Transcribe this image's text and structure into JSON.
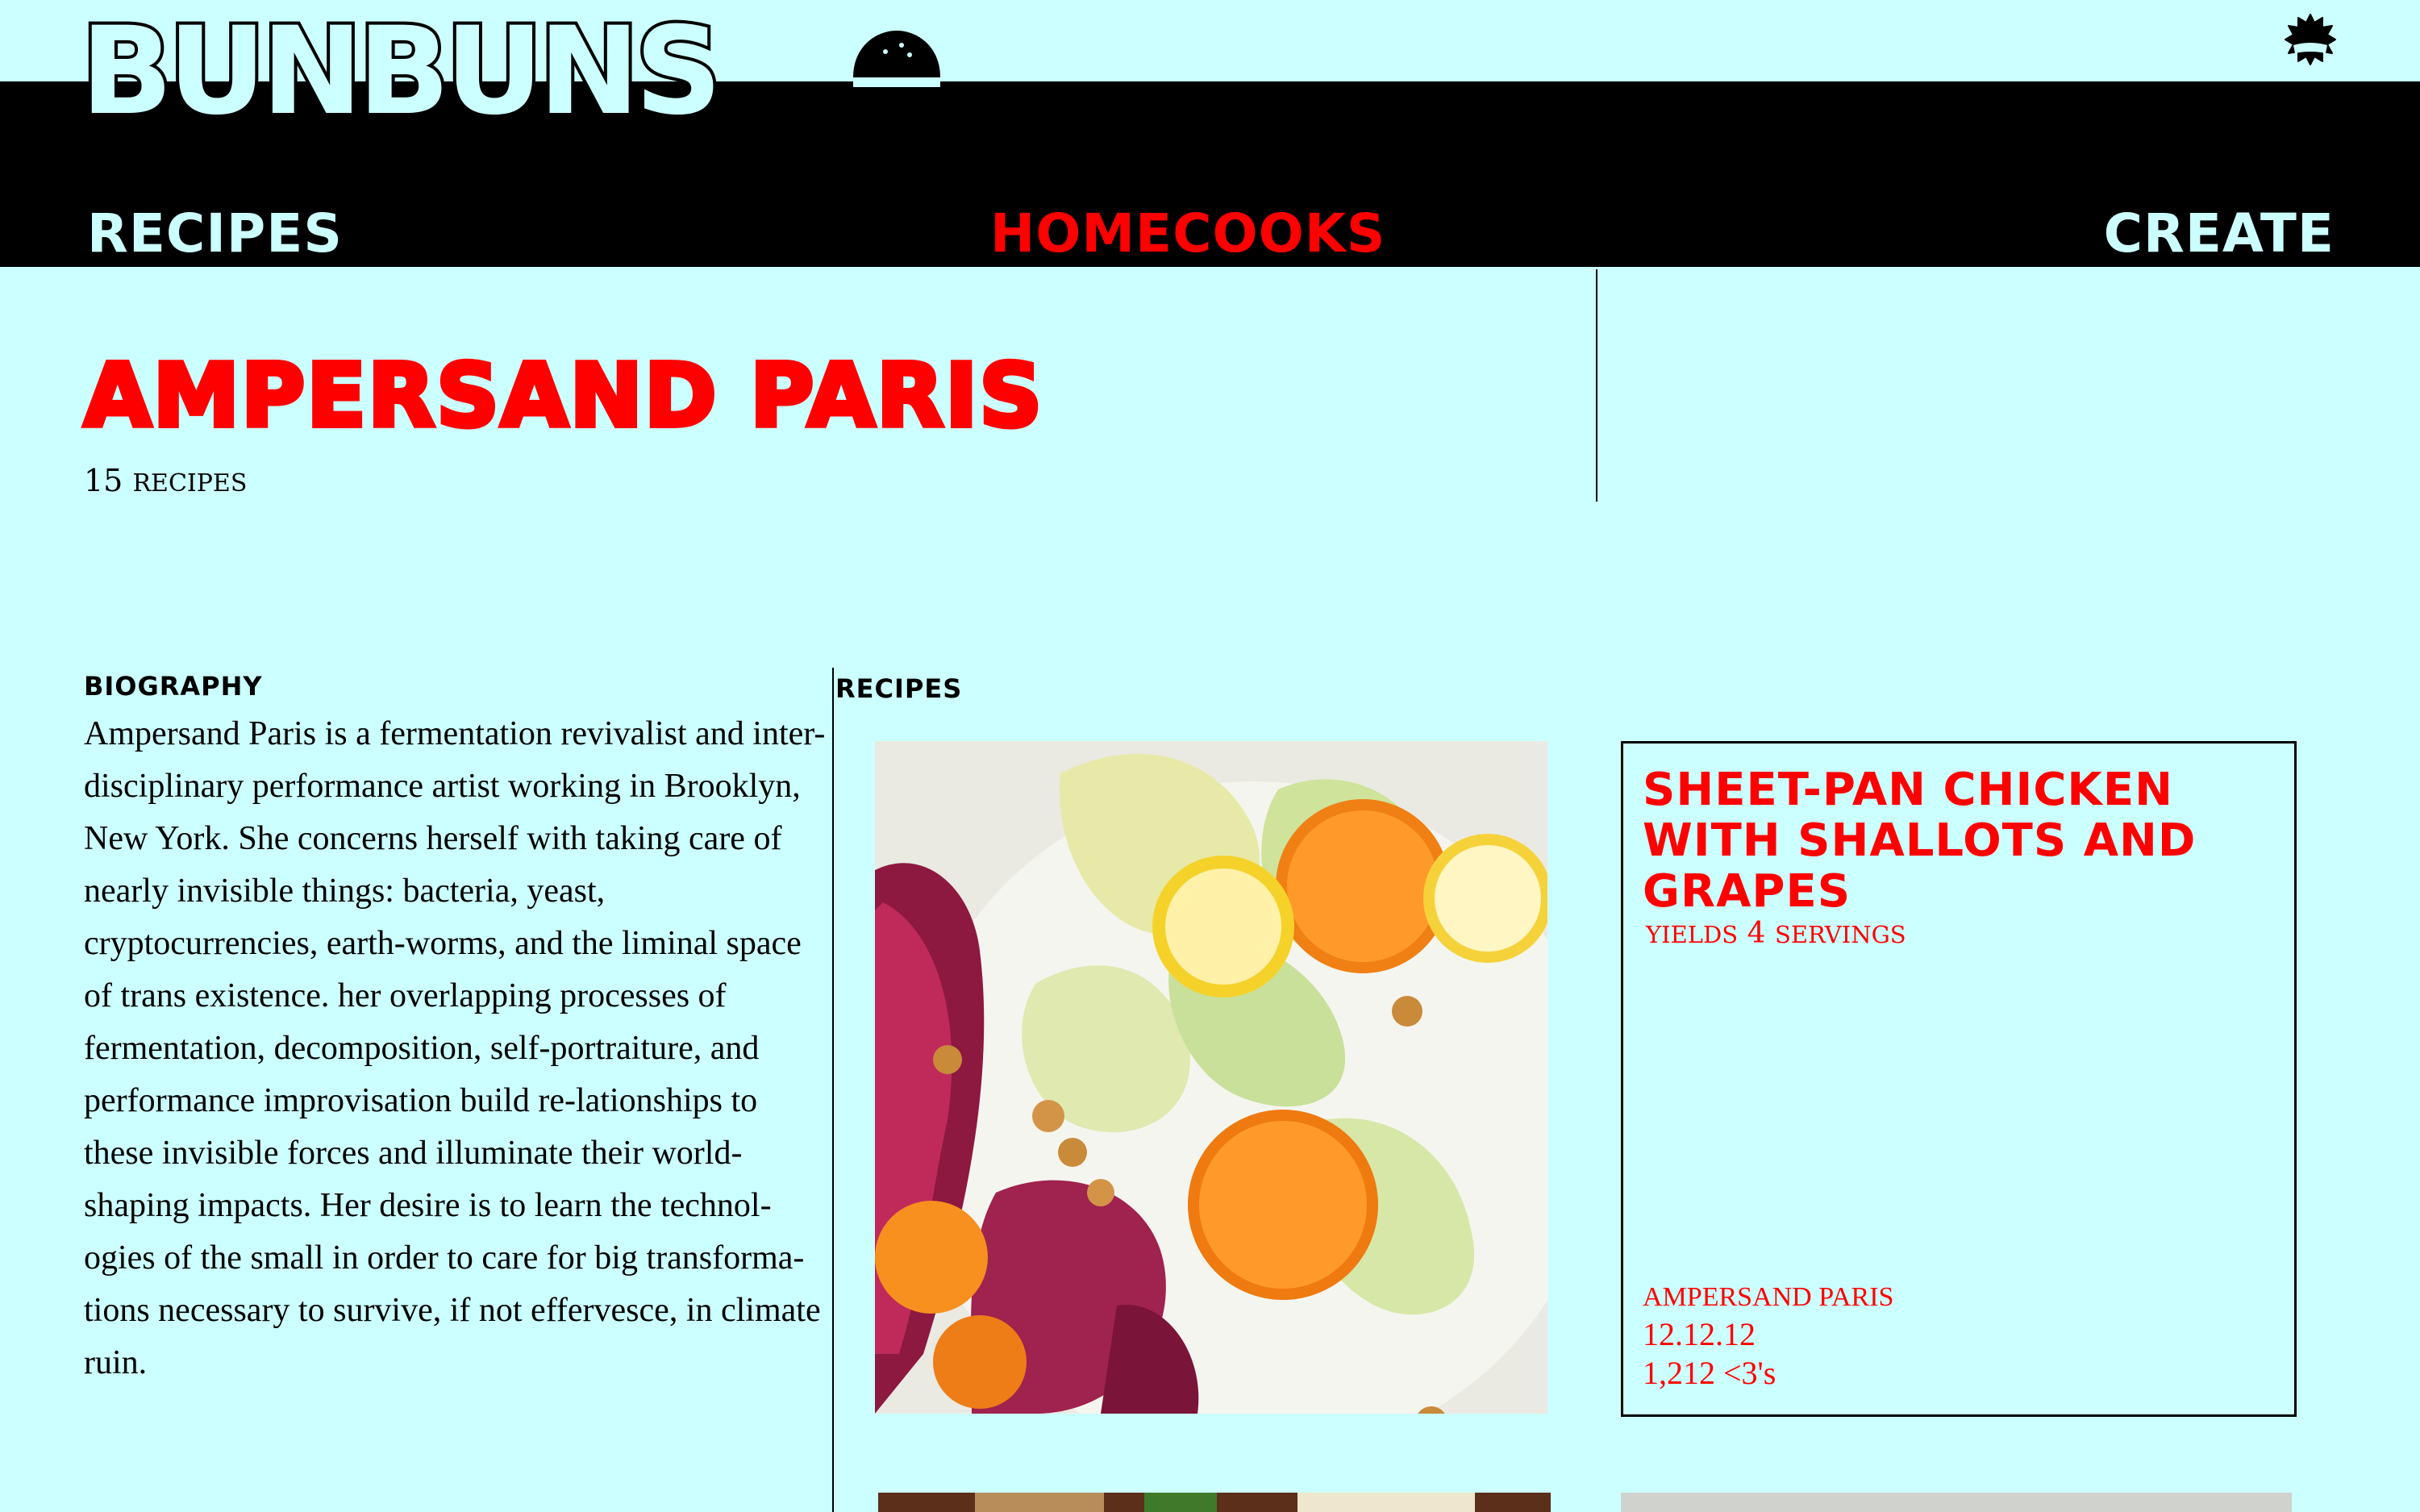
{
  "header": {
    "logo_text": "BUNBUNS",
    "nav": [
      {
        "label": "RECIPES"
      },
      {
        "label": "HOMECOOKS"
      },
      {
        "label": "CREATE"
      }
    ]
  },
  "profile": {
    "name": "AMPERSAND PARIS",
    "recipe_count_number": "15",
    "recipe_count_word": "RECIPES"
  },
  "biography": {
    "label": "BIOGRAPHY",
    "text": "Ampersand Paris is a fermentation revivalist and inter-disciplinary performance artist working in Brooklyn, New York. She concerns herself with taking care of nearly invisible things: bacteria, yeast, cryptocurrencies, earth-worms, and the liminal space of trans existence. her overlapping processes of fermentation, decomposition, self-portraiture, and performance improvisation build re-lationships to these invisible forces and illuminate their world-shaping impacts. Her desire is to learn the technol-ogies of the small in order to care for big transforma-tions necessary to survive, if not effervesce, in climate ruin."
  },
  "recipes_section": {
    "label": "RECIPES",
    "cards": [
      {
        "title": "SHEET-PAN CHICKEN WITH SHALLOTS AND GRAPES",
        "yield_word": "YIELDS",
        "yield_number": "4",
        "yield_unit": "SERVINGS",
        "author": "AMPERSAND PARIS",
        "date": "12.12.12",
        "likes": "1,212 <3's"
      }
    ]
  },
  "icons": {
    "settings": "gear-icon",
    "logo_mark": "bun-icon"
  },
  "colors": {
    "background": "#ccffff",
    "band": "#000000",
    "accent": "#ff0000"
  }
}
